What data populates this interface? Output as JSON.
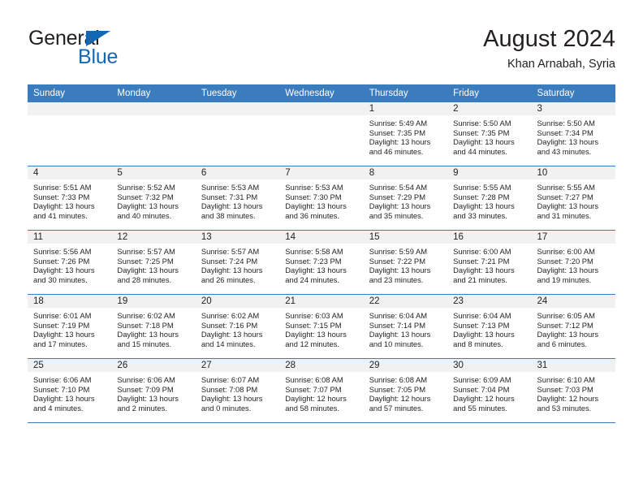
{
  "brand": {
    "name_top": "General",
    "name_bottom": "Blue",
    "accent_color": "#1268b3"
  },
  "header": {
    "title": "August 2024",
    "subtitle": "Khan Arnabah, Syria"
  },
  "theme": {
    "header_row_bg": "#3a7cbe",
    "header_row_text": "#ffffff",
    "daynum_band_bg": "#f1f1f1",
    "row_divider": "#3a7cbe",
    "text": "#231f20"
  },
  "weekday_headers": [
    "Sunday",
    "Monday",
    "Tuesday",
    "Wednesday",
    "Thursday",
    "Friday",
    "Saturday"
  ],
  "labels": {
    "sunrise_prefix": "Sunrise:",
    "sunset_prefix": "Sunset:",
    "daylight_prefix": "Daylight:"
  },
  "weeks": [
    [
      {
        "day": "",
        "blank": true,
        "line1": "",
        "line2": "",
        "line3": "",
        "line4": ""
      },
      {
        "day": "",
        "blank": true,
        "line1": "",
        "line2": "",
        "line3": "",
        "line4": ""
      },
      {
        "day": "",
        "blank": true,
        "line1": "",
        "line2": "",
        "line3": "",
        "line4": ""
      },
      {
        "day": "",
        "blank": true,
        "line1": "",
        "line2": "",
        "line3": "",
        "line4": ""
      },
      {
        "day": "1",
        "blank": false,
        "line1": "Sunrise: 5:49 AM",
        "line2": "Sunset: 7:35 PM",
        "line3": "Daylight: 13 hours",
        "line4": "and 46 minutes."
      },
      {
        "day": "2",
        "blank": false,
        "line1": "Sunrise: 5:50 AM",
        "line2": "Sunset: 7:35 PM",
        "line3": "Daylight: 13 hours",
        "line4": "and 44 minutes."
      },
      {
        "day": "3",
        "blank": false,
        "line1": "Sunrise: 5:50 AM",
        "line2": "Sunset: 7:34 PM",
        "line3": "Daylight: 13 hours",
        "line4": "and 43 minutes."
      }
    ],
    [
      {
        "day": "4",
        "blank": false,
        "line1": "Sunrise: 5:51 AM",
        "line2": "Sunset: 7:33 PM",
        "line3": "Daylight: 13 hours",
        "line4": "and 41 minutes."
      },
      {
        "day": "5",
        "blank": false,
        "line1": "Sunrise: 5:52 AM",
        "line2": "Sunset: 7:32 PM",
        "line3": "Daylight: 13 hours",
        "line4": "and 40 minutes."
      },
      {
        "day": "6",
        "blank": false,
        "line1": "Sunrise: 5:53 AM",
        "line2": "Sunset: 7:31 PM",
        "line3": "Daylight: 13 hours",
        "line4": "and 38 minutes."
      },
      {
        "day": "7",
        "blank": false,
        "line1": "Sunrise: 5:53 AM",
        "line2": "Sunset: 7:30 PM",
        "line3": "Daylight: 13 hours",
        "line4": "and 36 minutes."
      },
      {
        "day": "8",
        "blank": false,
        "line1": "Sunrise: 5:54 AM",
        "line2": "Sunset: 7:29 PM",
        "line3": "Daylight: 13 hours",
        "line4": "and 35 minutes."
      },
      {
        "day": "9",
        "blank": false,
        "line1": "Sunrise: 5:55 AM",
        "line2": "Sunset: 7:28 PM",
        "line3": "Daylight: 13 hours",
        "line4": "and 33 minutes."
      },
      {
        "day": "10",
        "blank": false,
        "line1": "Sunrise: 5:55 AM",
        "line2": "Sunset: 7:27 PM",
        "line3": "Daylight: 13 hours",
        "line4": "and 31 minutes."
      }
    ],
    [
      {
        "day": "11",
        "blank": false,
        "line1": "Sunrise: 5:56 AM",
        "line2": "Sunset: 7:26 PM",
        "line3": "Daylight: 13 hours",
        "line4": "and 30 minutes."
      },
      {
        "day": "12",
        "blank": false,
        "line1": "Sunrise: 5:57 AM",
        "line2": "Sunset: 7:25 PM",
        "line3": "Daylight: 13 hours",
        "line4": "and 28 minutes."
      },
      {
        "day": "13",
        "blank": false,
        "line1": "Sunrise: 5:57 AM",
        "line2": "Sunset: 7:24 PM",
        "line3": "Daylight: 13 hours",
        "line4": "and 26 minutes."
      },
      {
        "day": "14",
        "blank": false,
        "line1": "Sunrise: 5:58 AM",
        "line2": "Sunset: 7:23 PM",
        "line3": "Daylight: 13 hours",
        "line4": "and 24 minutes."
      },
      {
        "day": "15",
        "blank": false,
        "line1": "Sunrise: 5:59 AM",
        "line2": "Sunset: 7:22 PM",
        "line3": "Daylight: 13 hours",
        "line4": "and 23 minutes."
      },
      {
        "day": "16",
        "blank": false,
        "line1": "Sunrise: 6:00 AM",
        "line2": "Sunset: 7:21 PM",
        "line3": "Daylight: 13 hours",
        "line4": "and 21 minutes."
      },
      {
        "day": "17",
        "blank": false,
        "line1": "Sunrise: 6:00 AM",
        "line2": "Sunset: 7:20 PM",
        "line3": "Daylight: 13 hours",
        "line4": "and 19 minutes."
      }
    ],
    [
      {
        "day": "18",
        "blank": false,
        "line1": "Sunrise: 6:01 AM",
        "line2": "Sunset: 7:19 PM",
        "line3": "Daylight: 13 hours",
        "line4": "and 17 minutes."
      },
      {
        "day": "19",
        "blank": false,
        "line1": "Sunrise: 6:02 AM",
        "line2": "Sunset: 7:18 PM",
        "line3": "Daylight: 13 hours",
        "line4": "and 15 minutes."
      },
      {
        "day": "20",
        "blank": false,
        "line1": "Sunrise: 6:02 AM",
        "line2": "Sunset: 7:16 PM",
        "line3": "Daylight: 13 hours",
        "line4": "and 14 minutes."
      },
      {
        "day": "21",
        "blank": false,
        "line1": "Sunrise: 6:03 AM",
        "line2": "Sunset: 7:15 PM",
        "line3": "Daylight: 13 hours",
        "line4": "and 12 minutes."
      },
      {
        "day": "22",
        "blank": false,
        "line1": "Sunrise: 6:04 AM",
        "line2": "Sunset: 7:14 PM",
        "line3": "Daylight: 13 hours",
        "line4": "and 10 minutes."
      },
      {
        "day": "23",
        "blank": false,
        "line1": "Sunrise: 6:04 AM",
        "line2": "Sunset: 7:13 PM",
        "line3": "Daylight: 13 hours",
        "line4": "and 8 minutes."
      },
      {
        "day": "24",
        "blank": false,
        "line1": "Sunrise: 6:05 AM",
        "line2": "Sunset: 7:12 PM",
        "line3": "Daylight: 13 hours",
        "line4": "and 6 minutes."
      }
    ],
    [
      {
        "day": "25",
        "blank": false,
        "line1": "Sunrise: 6:06 AM",
        "line2": "Sunset: 7:10 PM",
        "line3": "Daylight: 13 hours",
        "line4": "and 4 minutes."
      },
      {
        "day": "26",
        "blank": false,
        "line1": "Sunrise: 6:06 AM",
        "line2": "Sunset: 7:09 PM",
        "line3": "Daylight: 13 hours",
        "line4": "and 2 minutes."
      },
      {
        "day": "27",
        "blank": false,
        "line1": "Sunrise: 6:07 AM",
        "line2": "Sunset: 7:08 PM",
        "line3": "Daylight: 13 hours",
        "line4": "and 0 minutes."
      },
      {
        "day": "28",
        "blank": false,
        "line1": "Sunrise: 6:08 AM",
        "line2": "Sunset: 7:07 PM",
        "line3": "Daylight: 12 hours",
        "line4": "and 58 minutes."
      },
      {
        "day": "29",
        "blank": false,
        "line1": "Sunrise: 6:08 AM",
        "line2": "Sunset: 7:05 PM",
        "line3": "Daylight: 12 hours",
        "line4": "and 57 minutes."
      },
      {
        "day": "30",
        "blank": false,
        "line1": "Sunrise: 6:09 AM",
        "line2": "Sunset: 7:04 PM",
        "line3": "Daylight: 12 hours",
        "line4": "and 55 minutes."
      },
      {
        "day": "31",
        "blank": false,
        "line1": "Sunrise: 6:10 AM",
        "line2": "Sunset: 7:03 PM",
        "line3": "Daylight: 12 hours",
        "line4": "and 53 minutes."
      }
    ]
  ]
}
